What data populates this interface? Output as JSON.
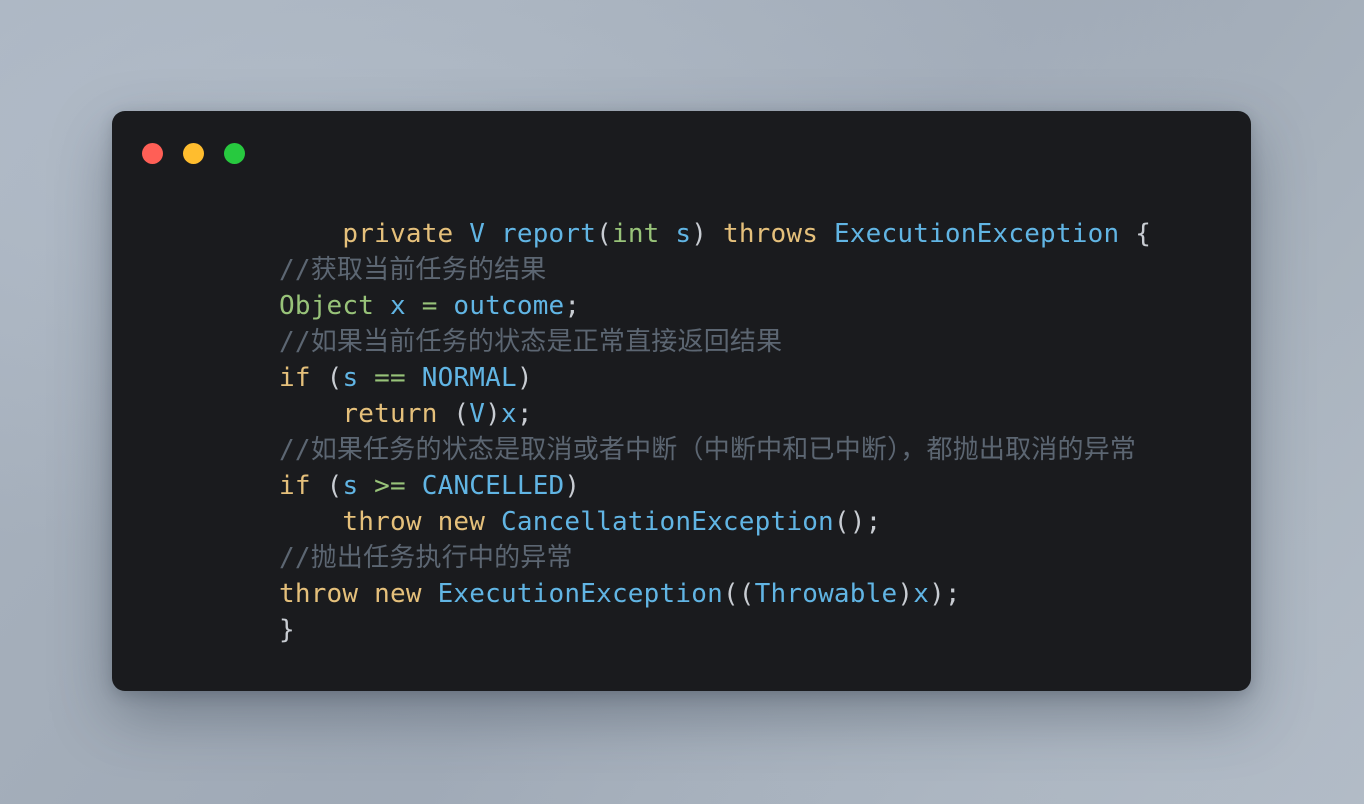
{
  "window": {
    "background_color": "#1a1b1e",
    "page_background_color": "#a4aeba",
    "traffic_lights": [
      {
        "name": "close",
        "label": "Close",
        "color": "#ff5f56"
      },
      {
        "name": "minimize",
        "label": "Minimize",
        "color": "#ffbd2e"
      },
      {
        "name": "maximize",
        "label": "Maximize",
        "color": "#27c93f"
      }
    ]
  },
  "theme": {
    "keyword": "#e5c07b",
    "type": "#98c379",
    "identifier": "#61b5e4",
    "class": "#61b5e4",
    "operator": "#98c379",
    "punctuation": "#c8ccd2",
    "plain": "#d6d9de",
    "comment": "#5c6672"
  },
  "code": {
    "language": "java",
    "plain_text": "    private V report(int s) throws ExecutionException {\n//获取当前任务的结果\nObject x = outcome;\n//如果当前任务的状态是正常直接返回结果\nif (s == NORMAL)\n    return (V)x;\n//如果任务的状态是取消或者中断（中断中和已中断），都抛出取消的异常\nif (s >= CANCELLED)\n    throw new CancellationException();\n//抛出任务执行中的异常\nthrow new ExecutionException((Throwable)x);\n}",
    "lines": [
      {
        "id": "line-1",
        "tokens": [
          {
            "t": "    ",
            "c": "plain"
          },
          {
            "t": "private",
            "c": "keyword"
          },
          {
            "t": " ",
            "c": "plain"
          },
          {
            "t": "V",
            "c": "identifier"
          },
          {
            "t": " ",
            "c": "plain"
          },
          {
            "t": "report",
            "c": "identifier"
          },
          {
            "t": "(",
            "c": "punctuation"
          },
          {
            "t": "int",
            "c": "type"
          },
          {
            "t": " ",
            "c": "plain"
          },
          {
            "t": "s",
            "c": "identifier"
          },
          {
            "t": ")",
            "c": "punctuation"
          },
          {
            "t": " ",
            "c": "plain"
          },
          {
            "t": "throws",
            "c": "keyword"
          },
          {
            "t": " ",
            "c": "plain"
          },
          {
            "t": "ExecutionException",
            "c": "class"
          },
          {
            "t": " ",
            "c": "plain"
          },
          {
            "t": "{",
            "c": "punctuation"
          }
        ]
      },
      {
        "id": "line-2",
        "tokens": [
          {
            "t": "//获取当前任务的结果",
            "c": "comment"
          }
        ]
      },
      {
        "id": "line-3",
        "tokens": [
          {
            "t": "Object",
            "c": "type"
          },
          {
            "t": " ",
            "c": "plain"
          },
          {
            "t": "x",
            "c": "identifier"
          },
          {
            "t": " ",
            "c": "plain"
          },
          {
            "t": "=",
            "c": "operator"
          },
          {
            "t": " ",
            "c": "plain"
          },
          {
            "t": "outcome",
            "c": "identifier"
          },
          {
            "t": ";",
            "c": "punctuation"
          }
        ]
      },
      {
        "id": "line-4",
        "tokens": [
          {
            "t": "//如果当前任务的状态是正常直接返回结果",
            "c": "comment"
          }
        ]
      },
      {
        "id": "line-5",
        "tokens": [
          {
            "t": "if",
            "c": "keyword"
          },
          {
            "t": " ",
            "c": "plain"
          },
          {
            "t": "(",
            "c": "punctuation"
          },
          {
            "t": "s",
            "c": "identifier"
          },
          {
            "t": " ",
            "c": "plain"
          },
          {
            "t": "==",
            "c": "operator"
          },
          {
            "t": " ",
            "c": "plain"
          },
          {
            "t": "NORMAL",
            "c": "class"
          },
          {
            "t": ")",
            "c": "punctuation"
          }
        ]
      },
      {
        "id": "line-6",
        "tokens": [
          {
            "t": "    ",
            "c": "plain"
          },
          {
            "t": "return",
            "c": "keyword"
          },
          {
            "t": " ",
            "c": "plain"
          },
          {
            "t": "(",
            "c": "punctuation"
          },
          {
            "t": "V",
            "c": "identifier"
          },
          {
            "t": ")",
            "c": "punctuation"
          },
          {
            "t": "x",
            "c": "identifier"
          },
          {
            "t": ";",
            "c": "punctuation"
          }
        ]
      },
      {
        "id": "line-7",
        "tokens": [
          {
            "t": "//如果任务的状态是取消或者中断（中断中和已中断），都抛出取消的异常",
            "c": "comment"
          }
        ]
      },
      {
        "id": "line-8",
        "tokens": [
          {
            "t": "if",
            "c": "keyword"
          },
          {
            "t": " ",
            "c": "plain"
          },
          {
            "t": "(",
            "c": "punctuation"
          },
          {
            "t": "s",
            "c": "identifier"
          },
          {
            "t": " ",
            "c": "plain"
          },
          {
            "t": ">=",
            "c": "operator"
          },
          {
            "t": " ",
            "c": "plain"
          },
          {
            "t": "CANCELLED",
            "c": "class"
          },
          {
            "t": ")",
            "c": "punctuation"
          }
        ]
      },
      {
        "id": "line-9",
        "tokens": [
          {
            "t": "    ",
            "c": "plain"
          },
          {
            "t": "throw",
            "c": "keyword"
          },
          {
            "t": " ",
            "c": "plain"
          },
          {
            "t": "new",
            "c": "keyword"
          },
          {
            "t": " ",
            "c": "plain"
          },
          {
            "t": "CancellationException",
            "c": "class"
          },
          {
            "t": "(",
            "c": "punctuation"
          },
          {
            "t": ")",
            "c": "punctuation"
          },
          {
            "t": ";",
            "c": "punctuation"
          }
        ]
      },
      {
        "id": "line-10",
        "tokens": [
          {
            "t": "//抛出任务执行中的异常",
            "c": "comment"
          }
        ]
      },
      {
        "id": "line-11",
        "tokens": [
          {
            "t": "throw",
            "c": "keyword"
          },
          {
            "t": " ",
            "c": "plain"
          },
          {
            "t": "new",
            "c": "keyword"
          },
          {
            "t": " ",
            "c": "plain"
          },
          {
            "t": "ExecutionException",
            "c": "class"
          },
          {
            "t": "(",
            "c": "punctuation"
          },
          {
            "t": "(",
            "c": "punctuation"
          },
          {
            "t": "Throwable",
            "c": "class"
          },
          {
            "t": ")",
            "c": "punctuation"
          },
          {
            "t": "x",
            "c": "identifier"
          },
          {
            "t": ")",
            "c": "punctuation"
          },
          {
            "t": ";",
            "c": "punctuation"
          }
        ]
      },
      {
        "id": "line-12",
        "tokens": [
          {
            "t": "}",
            "c": "punctuation"
          }
        ]
      }
    ]
  }
}
